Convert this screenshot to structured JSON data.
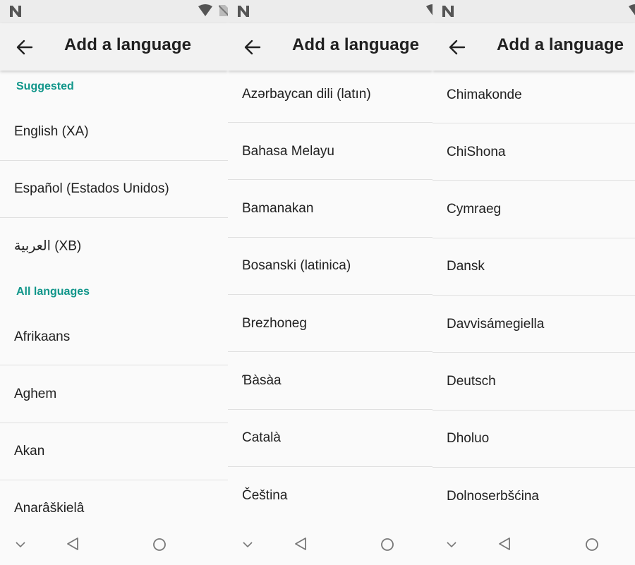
{
  "colors": {
    "accent": "#11968a",
    "status_bar": "#ececec",
    "app_bar": "#f2f2f2",
    "background": "#fafafa",
    "divider": "#e0e0e0",
    "text": "#212121"
  },
  "icons": {
    "status": [
      "notification-n-icon",
      "wifi-icon",
      "no-sim-icon"
    ],
    "app_bar": "back-arrow-icon",
    "nav_bar": [
      "chevron-down-icon",
      "nav-back-triangle-icon",
      "nav-home-circle-icon"
    ]
  },
  "screens": [
    {
      "title": "Add a language",
      "suggested_header": "Suggested",
      "suggested": [
        "English (XA)",
        "Español (Estados Unidos)",
        "‫العربية‬ (XB)"
      ],
      "all_header": "All languages",
      "languages": [
        "Afrikaans",
        "Aghem",
        "Akan",
        "Anarâškielâ"
      ]
    },
    {
      "title": "Add a language",
      "languages": [
        "Azərbaycan dili (latın)",
        "Bahasa Melayu",
        "Bamanakan",
        "Bosanski (latinica)",
        "Brezhoneg",
        "Ɓàsàa",
        "Català",
        "Čeština"
      ]
    },
    {
      "title": "Add a language",
      "languages": [
        "Chimakonde",
        "ChiShona",
        "Cymraeg",
        "Dansk",
        "Davvisámegiella",
        "Deutsch",
        "Dholuo",
        "Dolnoserbšćina"
      ]
    }
  ]
}
